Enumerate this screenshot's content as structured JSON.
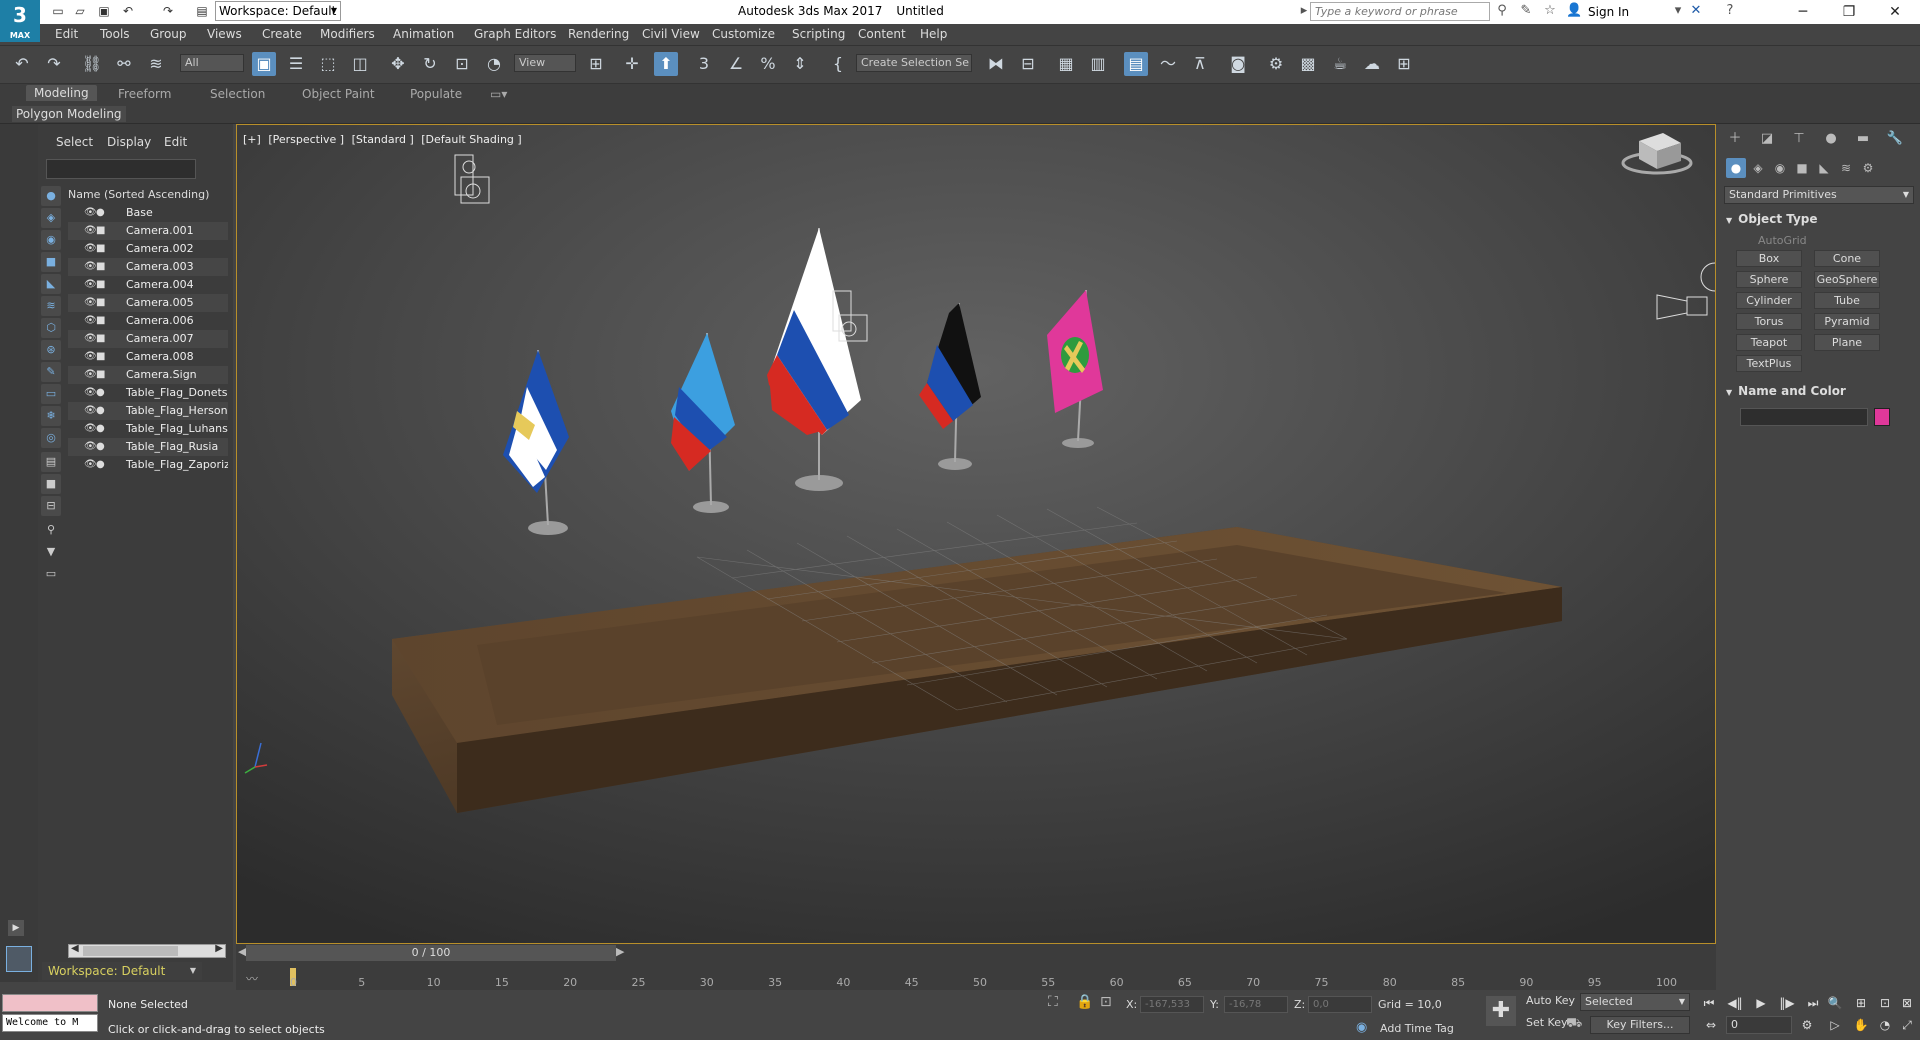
{
  "titlebar": {
    "logo": "3",
    "logo_sub": "MAX",
    "workspace": "Workspace: Default",
    "app_name": "Autodesk 3ds Max 2017",
    "doc_name": "Untitled",
    "search_placeholder": "Type a keyword or phrase",
    "signin": "Sign In"
  },
  "menu": [
    "Edit",
    "Tools",
    "Group",
    "Views",
    "Create",
    "Modifiers",
    "Animation",
    "Graph Editors",
    "Rendering",
    "Civil View",
    "Customize",
    "Scripting",
    "Content",
    "Help"
  ],
  "toolbar": {
    "filter_all": "All",
    "view_dd": "View",
    "selection_set": "Create Selection Se",
    "snap_3": "3",
    "snap_2": "2",
    "percent": "%"
  },
  "ribbon": {
    "tabs": [
      "Modeling",
      "Freeform",
      "Selection",
      "Object Paint",
      "Populate"
    ],
    "panel": "Polygon Modeling"
  },
  "scene": {
    "tabs": [
      "Select",
      "Display",
      "Edit"
    ],
    "header": "Name (Sorted Ascending)",
    "items": [
      "Base",
      "Camera.001",
      "Camera.002",
      "Camera.003",
      "Camera.004",
      "Camera.005",
      "Camera.006",
      "Camera.007",
      "Camera.008",
      "Camera.Sign",
      "Table_Flag_Donetsk",
      "Table_Flag_Herson",
      "Table_Flag_Luhansk",
      "Table_Flag_Rusia",
      "Table_Flag_Zaporizhzh"
    ],
    "workspace": "Workspace: Default"
  },
  "viewport": {
    "labels": [
      "[+]",
      "[Perspective ]",
      "[Standard ]",
      "[Default Shading ]"
    ]
  },
  "command_panel": {
    "dropdown": "Standard Primitives",
    "object_type": "Object Type",
    "autogrid": "AutoGrid",
    "buttons": [
      "Box",
      "Cone",
      "Sphere",
      "GeoSphere",
      "Cylinder",
      "Tube",
      "Torus",
      "Pyramid",
      "Teapot",
      "Plane",
      "TextPlus"
    ],
    "name_and_color": "Name and Color",
    "color": "#e0389a"
  },
  "timeline": {
    "frame": "0 / 100",
    "ticks": [
      "0",
      "5",
      "10",
      "15",
      "20",
      "25",
      "30",
      "35",
      "40",
      "45",
      "50",
      "55",
      "60",
      "65",
      "70",
      "75",
      "80",
      "85",
      "90",
      "95",
      "100"
    ]
  },
  "status": {
    "maxscript": "Welcome to M",
    "selection": "None Selected",
    "hint": "Click or click-and-drag to select objects",
    "x_label": "X:",
    "x": "-167,533",
    "y_label": "Y:",
    "y": "-16,78",
    "z_label": "Z:",
    "z": "0,0",
    "grid": "Grid = 10,0",
    "add_time_tag": "Add Time Tag",
    "auto_key": "Auto Key",
    "set_key": "Set Key",
    "selected": "Selected",
    "key_filters": "Key Filters...",
    "frame": "0"
  }
}
